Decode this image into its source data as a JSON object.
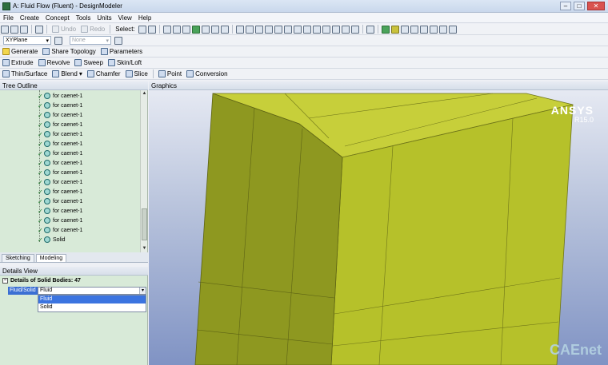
{
  "window": {
    "title": "A: Fluid Flow (Fluent) - DesignModeler"
  },
  "menu": [
    "File",
    "Create",
    "Concept",
    "Tools",
    "Units",
    "View",
    "Help"
  ],
  "toolbar1": {
    "undo_label": "Undo",
    "redo_label": "Redo",
    "select_label": "Select:"
  },
  "toolbar2": {
    "plane_value": "XYPlane",
    "sketch_value": "None"
  },
  "toolbar3": [
    "Generate",
    "Share Topology",
    "Parameters"
  ],
  "toolbar4": [
    "Extrude",
    "Revolve",
    "Sweep",
    "Skin/Loft"
  ],
  "toolbar5": [
    "Thin/Surface",
    "Blend",
    "Chamfer",
    "Slice",
    "Point",
    "Conversion"
  ],
  "tree_outline": {
    "header": "Tree Outline",
    "items": [
      "for caenet-1",
      "for caenet-1",
      "for caenet-1",
      "for caenet-1",
      "for caenet-1",
      "for caenet-1",
      "for caenet-1",
      "for caenet-1",
      "for caenet-1",
      "for caenet-1",
      "for caenet-1",
      "for caenet-1",
      "for caenet-1",
      "for caenet-1",
      "for caenet-1",
      "Solid"
    ]
  },
  "tabs": [
    "Sketching",
    "Modeling"
  ],
  "details": {
    "header": "Details View",
    "section_title": "Details of Solid Bodies: 47",
    "property_label": "Fluid/Solid",
    "property_value": "Fluid",
    "options": [
      "Fluid",
      "Solid"
    ],
    "highlighted_option": "Fluid"
  },
  "graphics": {
    "header": "Graphics",
    "logo_brand": "ANSYS",
    "logo_version": "R15.0",
    "watermark": "CAEnet"
  },
  "colors": {
    "model_face_top": "#c7cf3a",
    "model_face_front": "#b6c12a",
    "model_face_side": "#8e9820",
    "tree_background": "#d8ead8"
  }
}
